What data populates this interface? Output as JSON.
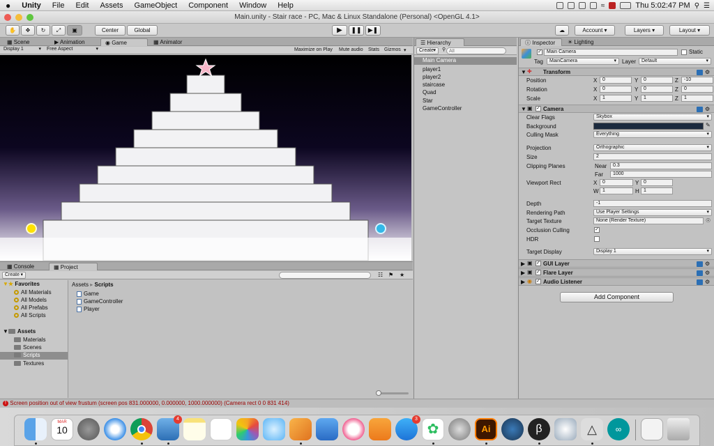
{
  "menubar": {
    "apple": "",
    "app_name": "Unity",
    "items": [
      "File",
      "Edit",
      "Assets",
      "GameObject",
      "Component",
      "Window",
      "Help"
    ],
    "clock": "Thu 5:02:47 PM"
  },
  "window": {
    "title": "Main.unity - Stair race - PC, Mac & Linux Standalone (Personal) <OpenGL 4.1>"
  },
  "toolbar": {
    "pivot": "Center",
    "space": "Global",
    "account": "Account",
    "layers": "Layers",
    "layout": "Layout"
  },
  "scene_tabs": [
    "Scene",
    "Animation",
    "Game",
    "Animator"
  ],
  "game_bar": {
    "display": "Display 1",
    "aspect": "Free Aspect",
    "maximize": "Maximize on Play",
    "mute": "Mute audio",
    "stats": "Stats",
    "gizmos": "Gizmos"
  },
  "hierarchy": {
    "tab": "Hierarchy",
    "create": "Create",
    "search_placeholder": "All",
    "items": [
      "Main Camera",
      "player1",
      "player2",
      "staircase",
      "Quad",
      "Star",
      "GameController"
    ]
  },
  "inspector": {
    "tabs": [
      "Inspector",
      "Lighting"
    ],
    "object_name": "Main Camera",
    "static_label": "Static",
    "tag_label": "Tag",
    "tag_value": "MainCamera",
    "layer_label": "Layer",
    "layer_value": "Default",
    "transform": {
      "title": "Transform",
      "position": {
        "label": "Position",
        "x": "0",
        "y": "0",
        "z": "-10"
      },
      "rotation": {
        "label": "Rotation",
        "x": "0",
        "y": "0",
        "z": "0"
      },
      "scale": {
        "label": "Scale",
        "x": "1",
        "y": "1",
        "z": "1"
      }
    },
    "camera": {
      "title": "Camera",
      "clear_flags_label": "Clear Flags",
      "clear_flags": "Skybox",
      "background_label": "Background",
      "background_color": "#1b2a3e",
      "culling_mask_label": "Culling Mask",
      "culling_mask": "Everything",
      "projection_label": "Projection",
      "projection": "Orthographic",
      "size_label": "Size",
      "size": "2",
      "clipping_label": "Clipping Planes",
      "near_label": "Near",
      "near": "0.3",
      "far_label": "Far",
      "far": "1000",
      "viewport_label": "Viewport Rect",
      "vx": "0",
      "vy": "0",
      "vw": "1",
      "vh": "1",
      "depth_label": "Depth",
      "depth": "-1",
      "rendering_label": "Rendering Path",
      "rendering": "Use Player Settings",
      "target_texture_label": "Target Texture",
      "target_texture": "None (Render Texture)",
      "occlusion_label": "Occlusion Culling",
      "hdr_label": "HDR",
      "target_display_label": "Target Display",
      "target_display": "Display 1"
    },
    "components": [
      "GUI Layer",
      "Flare Layer",
      "Audio Listener"
    ],
    "add_component": "Add Component"
  },
  "bottom_tabs": [
    "Console",
    "Project"
  ],
  "project": {
    "create": "Create",
    "favorites_label": "Favorites",
    "favorites": [
      "All Materials",
      "All Models",
      "All Prefabs",
      "All Scripts"
    ],
    "assets_label": "Assets",
    "folders": [
      "Materials",
      "Scenes",
      "Scripts",
      "Textures"
    ],
    "breadcrumb_root": "Assets",
    "breadcrumb_sep": "▸",
    "breadcrumb_current": "Scripts",
    "files": [
      "Game",
      "GameController",
      "Player"
    ]
  },
  "status": {
    "message": "Screen position out of view frustum (screen pos 831.000000, 0.000000, 1000.000000) (Camera rect 0 0 831 414)"
  },
  "dock": {
    "calendar_month": "MAR",
    "calendar_day": "10",
    "badge_1": "4",
    "badge_2": "3"
  },
  "colors": {
    "selection": "#8e8e8e",
    "error_red": "#cc1111",
    "scene_sky_top": "#000000",
    "scene_sky_bottom": "#ffffff"
  }
}
